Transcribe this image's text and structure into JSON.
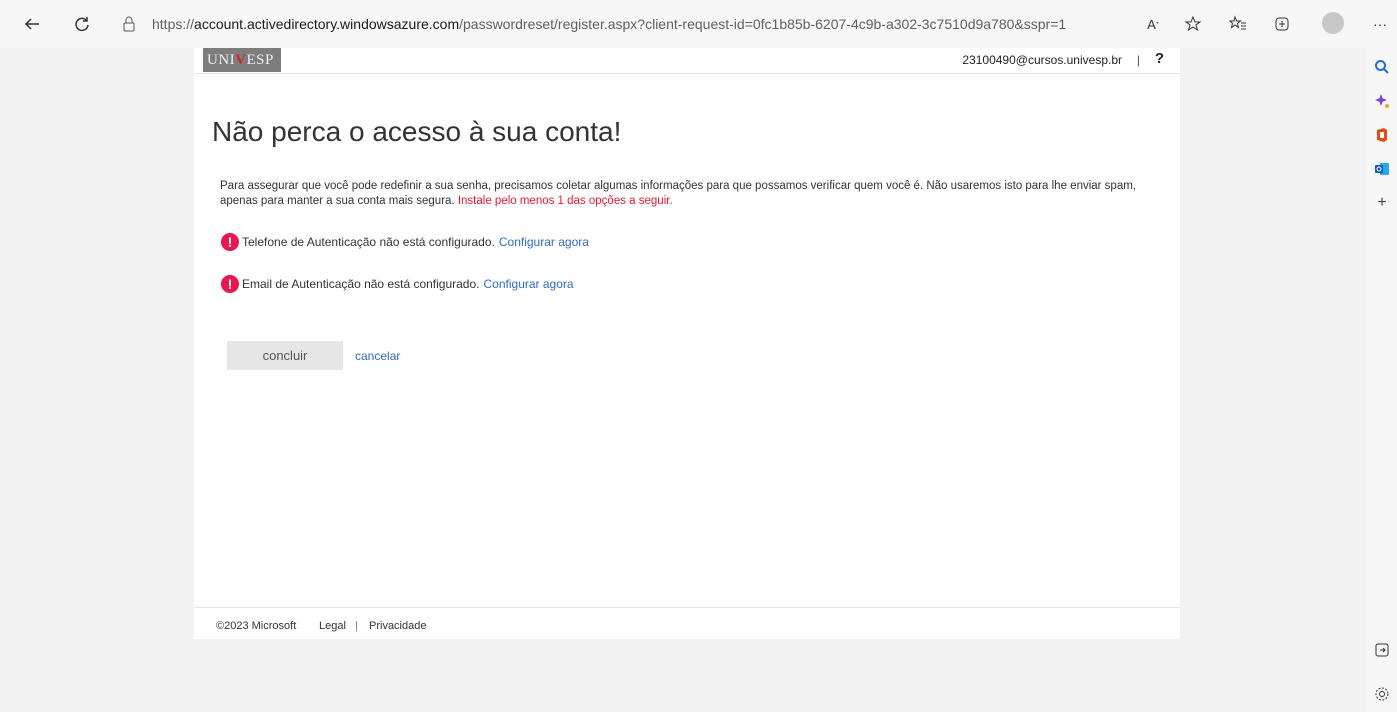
{
  "browser": {
    "url_prefix": "https://",
    "url_host": "account.activedirectory.windowsazure.com",
    "url_path": "/passwordreset/register.aspx?client-request-id=0fc1b85b-6207-4c9b-a302-3c7510d9a780&sspr=1",
    "more_label": "···"
  },
  "header": {
    "logo_text_pre": "UNI",
    "logo_text_v": "V",
    "logo_text_post": "ESP",
    "user": "23100490@cursos.univesp.br",
    "separator": "|",
    "help": "?"
  },
  "main": {
    "title": "Não perca o acesso à sua conta!",
    "description": "Para assegurar que você pode redefinir a sua senha, precisamos coletar algumas informações para que possamos verificar quem você é. Não usaremos isto para lhe enviar spam, apenas para manter a sua conta mais segura.",
    "warning": "Instale pelo menos 1 das opções a seguir.",
    "items": [
      {
        "text": "Telefone de Autenticação não está configurado.",
        "link": "Configurar agora"
      },
      {
        "text": "Email de Autenticação não está configurado.",
        "link": "Configurar agora"
      }
    ],
    "alert_glyph": "!",
    "finish_label": "concluir",
    "cancel_label": "cancelar"
  },
  "footer": {
    "copyright": "©2023 Microsoft",
    "legal": "Legal",
    "separator": "|",
    "privacy": "Privacidade"
  },
  "colors": {
    "alert": "#e8174f",
    "link": "#2f6bcb",
    "warning": "#e8192c"
  }
}
